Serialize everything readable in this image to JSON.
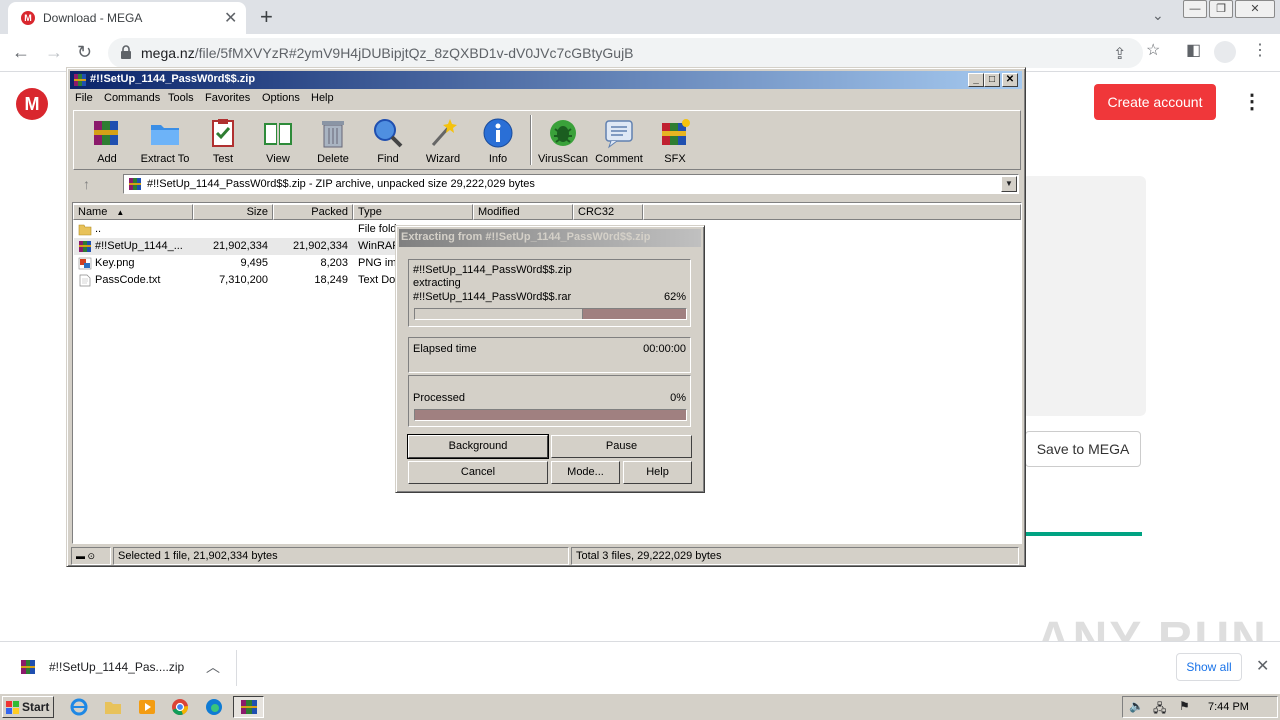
{
  "browser": {
    "tab_title": "Download - MEGA",
    "tab_favicon": "M",
    "url_host": "mega.nz",
    "url_path": "/file/5fMXVYzR#2ymV9H4jDUBipjtQz_8zQXBD1v-dV0JVc7cGBtyGujB"
  },
  "mega": {
    "logo": "M",
    "create_account": "Create account",
    "save_to_mega": "Save to MEGA"
  },
  "winrar": {
    "title": "#!!SetUp_1144_PassW0rd$$.zip",
    "menu": [
      "File",
      "Commands",
      "Tools",
      "Favorites",
      "Options",
      "Help"
    ],
    "tools": [
      "Add",
      "Extract To",
      "Test",
      "View",
      "Delete",
      "Find",
      "Wizard",
      "Info",
      "VirusScan",
      "Comment",
      "SFX"
    ],
    "path": "#!!SetUp_1144_PassW0rd$$.zip - ZIP archive, unpacked size 29,222,029 bytes",
    "columns": [
      "Name",
      "Size",
      "Packed",
      "Type",
      "Modified",
      "CRC32"
    ],
    "files": [
      {
        "name": "..",
        "size": "",
        "packed": "",
        "type": "File fold"
      },
      {
        "name": "#!!SetUp_1144_...",
        "size": "21,902,334",
        "packed": "21,902,334",
        "type": "WinRAR"
      },
      {
        "name": "Key.png",
        "size": "9,495",
        "packed": "8,203",
        "type": "PNG ima"
      },
      {
        "name": "PassCode.txt",
        "size": "7,310,200",
        "packed": "18,249",
        "type": "Text Do"
      }
    ],
    "status_left": "Selected 1 file, 21,902,334 bytes",
    "status_right": "Total 3 files, 29,222,029 bytes"
  },
  "extract_dialog": {
    "title": "Extracting from #!!SetUp_1144_PassW0rd$$.zip",
    "archive": "#!!SetUp_1144_PassW0rd$$.zip",
    "action": "extracting",
    "current_file": "#!!SetUp_1144_PassW0rd$$.rar",
    "file_percent": "62%",
    "file_progress": 0.62,
    "elapsed_label": "Elapsed time",
    "elapsed_value": "00:00:00",
    "processed_label": "Processed",
    "processed_value": "0%",
    "processed_progress": 0.0,
    "buttons": {
      "background": "Background",
      "pause": "Pause",
      "cancel": "Cancel",
      "mode": "Mode...",
      "help": "Help"
    }
  },
  "download_shelf": {
    "file_name": "#!!SetUp_1144_Pas....zip",
    "show_all": "Show all"
  },
  "watermark": "ANY RUN",
  "taskbar": {
    "start": "Start",
    "clock": "7:44 PM"
  }
}
